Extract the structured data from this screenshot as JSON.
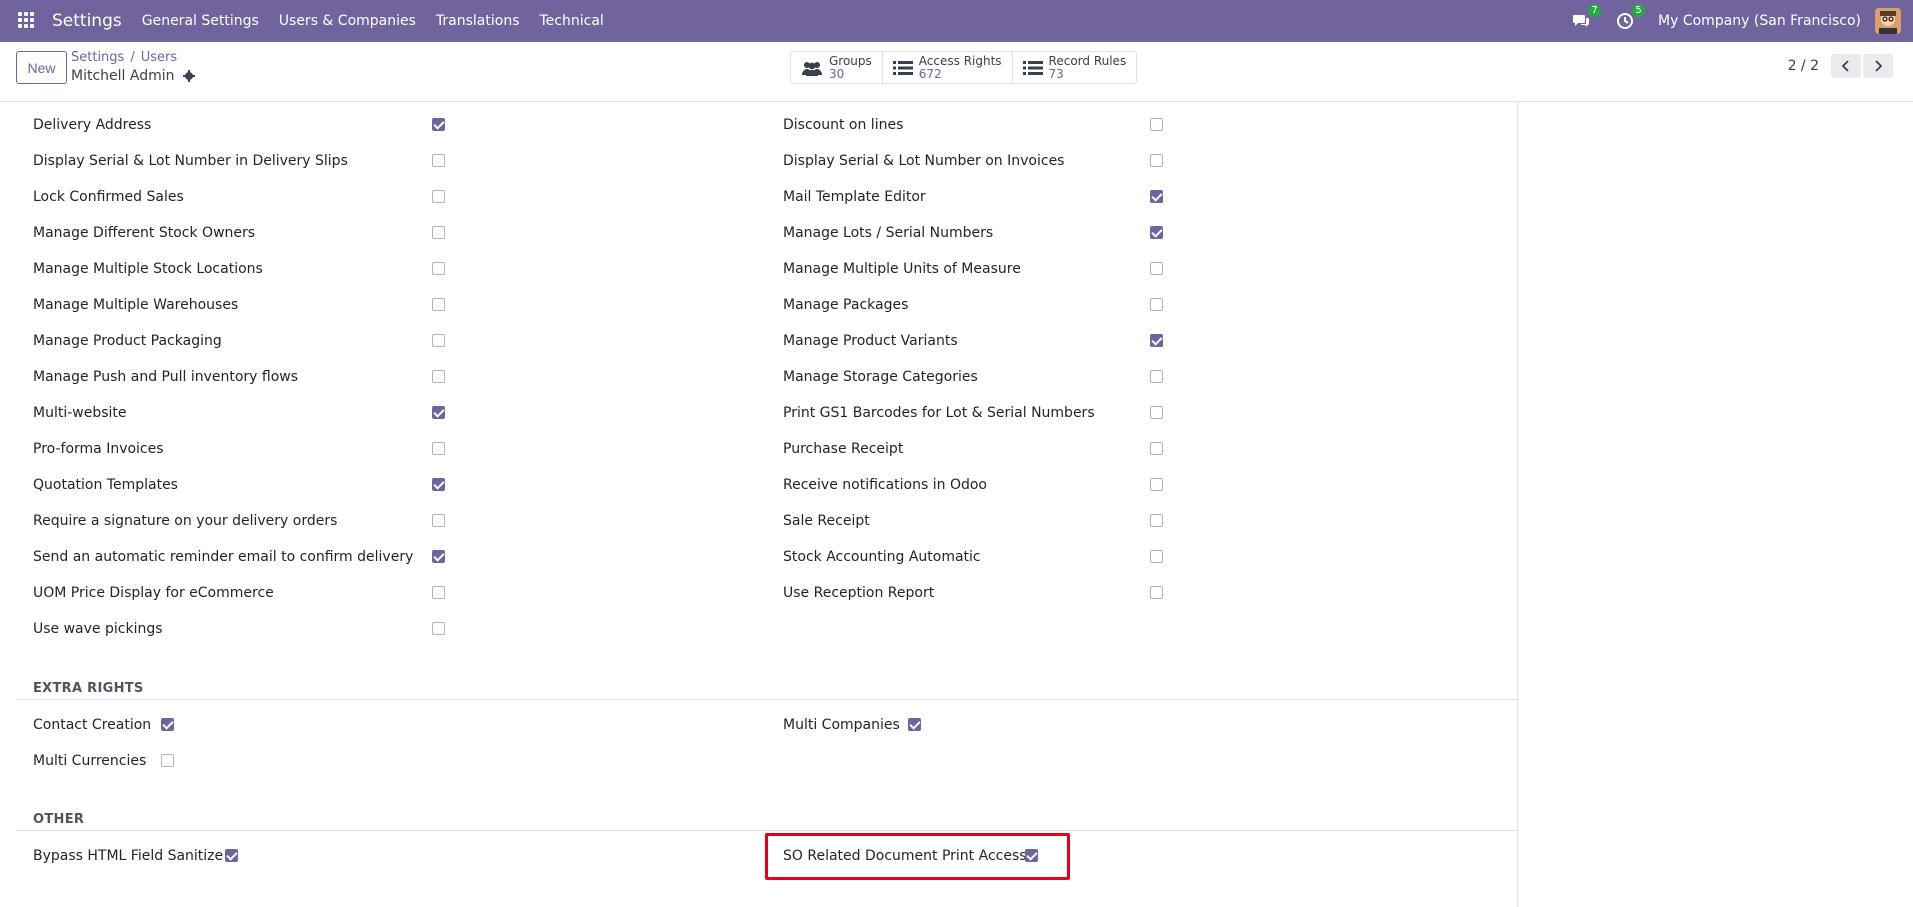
{
  "navbar": {
    "brand": "Settings",
    "menu": [
      "General Settings",
      "Users & Companies",
      "Translations",
      "Technical"
    ],
    "messages_badge": "7",
    "activities_badge": "5",
    "company": "My Company (San Francisco)"
  },
  "control": {
    "new_label": "New",
    "breadcrumb": [
      "Settings",
      "Users"
    ],
    "record_name": "Mitchell Admin",
    "stats": [
      {
        "label": "Groups",
        "value": "30",
        "icon": "users-icon"
      },
      {
        "label": "Access Rights",
        "value": "672",
        "icon": "list-icon"
      },
      {
        "label": "Record Rules",
        "value": "73",
        "icon": "list-icon"
      }
    ],
    "pager": "2 / 2"
  },
  "rights_left": [
    {
      "label": "Delivery Address",
      "checked": true
    },
    {
      "label": "Display Serial & Lot Number in Delivery Slips",
      "checked": false
    },
    {
      "label": "Lock Confirmed Sales",
      "checked": false
    },
    {
      "label": "Manage Different Stock Owners",
      "checked": false
    },
    {
      "label": "Manage Multiple Stock Locations",
      "checked": false
    },
    {
      "label": "Manage Multiple Warehouses",
      "checked": false
    },
    {
      "label": "Manage Product Packaging",
      "checked": false
    },
    {
      "label": "Manage Push and Pull inventory flows",
      "checked": false
    },
    {
      "label": "Multi-website",
      "checked": true
    },
    {
      "label": "Pro-forma Invoices",
      "checked": false
    },
    {
      "label": "Quotation Templates",
      "checked": true
    },
    {
      "label": "Require a signature on your delivery orders",
      "checked": false
    },
    {
      "label": "Send an automatic reminder email to confirm delivery",
      "checked": true
    },
    {
      "label": "UOM Price Display for eCommerce",
      "checked": false
    },
    {
      "label": "Use wave pickings",
      "checked": false
    }
  ],
  "rights_right": [
    {
      "label": "Discount on lines",
      "checked": false
    },
    {
      "label": "Display Serial & Lot Number on Invoices",
      "checked": false
    },
    {
      "label": "Mail Template Editor",
      "checked": true
    },
    {
      "label": "Manage Lots / Serial Numbers",
      "checked": true
    },
    {
      "label": "Manage Multiple Units of Measure",
      "checked": false
    },
    {
      "label": "Manage Packages",
      "checked": false
    },
    {
      "label": "Manage Product Variants",
      "checked": true
    },
    {
      "label": "Manage Storage Categories",
      "checked": false
    },
    {
      "label": "Print GS1 Barcodes for Lot & Serial Numbers",
      "checked": false
    },
    {
      "label": "Purchase Receipt",
      "checked": false
    },
    {
      "label": "Receive notifications in Odoo",
      "checked": false
    },
    {
      "label": "Sale Receipt",
      "checked": false
    },
    {
      "label": "Stock Accounting Automatic",
      "checked": false
    },
    {
      "label": "Use Reception Report",
      "checked": false
    }
  ],
  "extra_rights": {
    "title": "EXTRA RIGHTS",
    "left": [
      {
        "label": "Contact Creation",
        "checked": true
      },
      {
        "label": "Multi Currencies",
        "checked": false
      }
    ],
    "right": [
      {
        "label": "Multi Companies",
        "checked": true
      }
    ]
  },
  "other": {
    "title": "OTHER",
    "left": [
      {
        "label": "Bypass HTML Field Sanitize",
        "checked": true
      }
    ],
    "right": [
      {
        "label": "SO Related Document Print Access",
        "checked": true
      }
    ]
  },
  "colors": {
    "accent": "#71639e",
    "highlight": "#e6001f",
    "badge": "#28a745"
  }
}
